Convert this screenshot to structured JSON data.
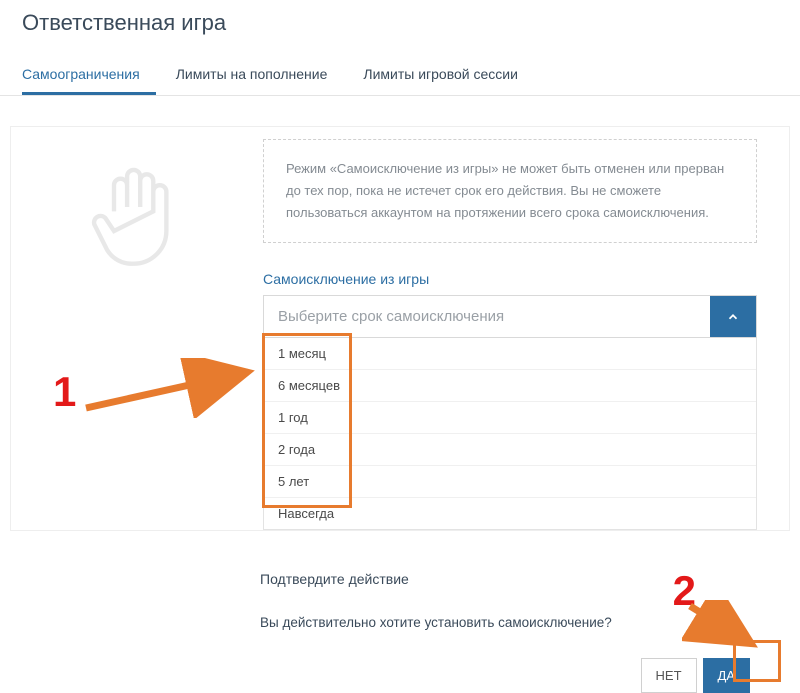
{
  "page": {
    "title": "Ответственная игра"
  },
  "tabs": {
    "items": [
      {
        "label": "Самоограничения",
        "active": true
      },
      {
        "label": "Лимиты на пополнение",
        "active": false
      },
      {
        "label": "Лимиты игровой сессии",
        "active": false
      }
    ]
  },
  "info": {
    "text": "Режим «Самоисключение из игры» не может быть отменен или прерван до тех пор, пока не истечет срок его действия. Вы не сможете пользоваться аккаунтом на протяжении всего срока самоисключения."
  },
  "select": {
    "label": "Самоисключение из игры",
    "placeholder": "Выберите срок самоисключения",
    "options": [
      "1 месяц",
      "6 месяцев",
      "1 год",
      "2 года",
      "5 лет",
      "Навсегда"
    ]
  },
  "confirm": {
    "title": "Подтвердите действие",
    "question": "Вы действительно хотите установить самоисключение?",
    "no": "НЕТ",
    "yes": "ДА"
  },
  "annotations": {
    "one": "1",
    "two": "2"
  }
}
